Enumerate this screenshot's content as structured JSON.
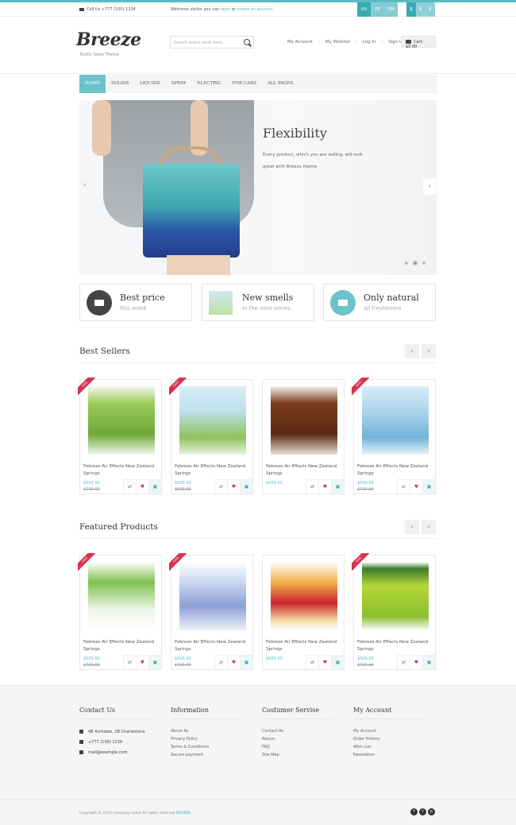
{
  "topbar": {
    "call": "Call Us +777 (100) 1234",
    "welcome_prefix": "Welcome visitor you can",
    "login": "login",
    "or": "or",
    "create": "create an account.",
    "languages": [
      "EN",
      "FR",
      "DM"
    ],
    "active_language": "EN",
    "currencies": [
      "$",
      "€",
      "£"
    ],
    "active_currency": "$"
  },
  "header": {
    "logo": "Breeze",
    "tagline": "Ecotic Store Theme",
    "search_placeholder": "Search entire store here...",
    "links": [
      "My Account",
      "My Wishlist",
      "Log In",
      "Sign Up"
    ],
    "cart": "Cart: $0.00"
  },
  "nav": [
    "HOME",
    "SOLIDS",
    "LIQUIDS",
    "SPRAY",
    "ELECTRIC",
    "FOR CARS",
    "ALL PAGES"
  ],
  "slider": {
    "title": "Flexibility",
    "text": "Every product, which you are selling, will look great with Breeze theme."
  },
  "features": [
    {
      "title": "Best price",
      "sub": "this week",
      "icon": "sale-tag-icon"
    },
    {
      "title": "New smells",
      "sub": "in the next series",
      "icon": "product-thumbnail-icon"
    },
    {
      "title": "Only natural",
      "sub": "all fresheners",
      "icon": "barcode-icon"
    }
  ],
  "best_sellers": {
    "title": "Best Sellers",
    "products": [
      {
        "name": "Febreze Air Effects New Zealand Springs",
        "price": "$500.00",
        "old_price": "$725.00",
        "sale": true,
        "color": "green-spray"
      },
      {
        "name": "Febreze Air Effects New Zealand Springs",
        "price": "$500.00",
        "old_price": "$625.00",
        "sale": true,
        "color": "green-box"
      },
      {
        "name": "Febreze Air Effects New Zealand Springs",
        "price": "$500.00",
        "old_price": "",
        "sale": false,
        "color": "brown-candle"
      },
      {
        "name": "Febreze Air Effects New Zealand Springs",
        "price": "$500.00",
        "old_price": "$725.00",
        "sale": true,
        "color": "blue-box"
      }
    ]
  },
  "featured": {
    "title": "Featured Products",
    "products": [
      {
        "name": "Febreze Air Effects New Zealand Springs",
        "price": "$500.00",
        "old_price": "$725.00",
        "sale": true,
        "color": "green-plugin"
      },
      {
        "name": "Febreze Air Effects New Zealand Springs",
        "price": "$500.00",
        "old_price": "$725.00",
        "sale": true,
        "color": "lilac-plugin"
      },
      {
        "name": "Febreze Air Effects New Zealand Springs",
        "price": "$500.00",
        "old_price": "",
        "sale": false,
        "color": "incense-box"
      },
      {
        "name": "Febreze Air Effects New Zealand Springs",
        "price": "$500.00",
        "old_price": "$725.00",
        "sale": true,
        "color": "chai-tin"
      }
    ]
  },
  "footer": {
    "contact": {
      "title": "Contact Us",
      "address": "4B Archdale, 2B Charlestone",
      "phone": "+777 (100) 1234",
      "email": "mail@example.com"
    },
    "information": {
      "title": "Information",
      "items": [
        "About As",
        "Privacy Policy",
        "Terms & Conditions",
        "Secure payment"
      ]
    },
    "service": {
      "title": "Costumer Servise",
      "items": [
        "Contact As",
        "Return",
        "FAQ",
        "Site Map"
      ]
    },
    "account": {
      "title": "My Account",
      "items": [
        "My Account",
        "Order History",
        "Wish List",
        "Newsletter"
      ]
    },
    "copyright": "Copyright © 2014 Company name All rights reserved",
    "copyright_link": "网页模板"
  }
}
